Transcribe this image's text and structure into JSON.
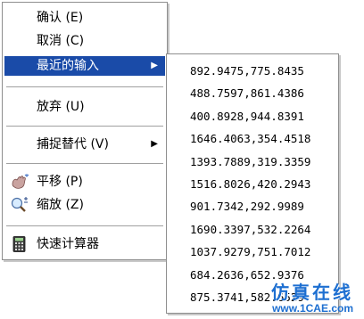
{
  "menu": {
    "items": [
      {
        "label": "确认 (E)"
      },
      {
        "label": "取消 (C)"
      },
      {
        "label": "最近的输入"
      },
      {
        "label": "放弃 (U)"
      },
      {
        "label": "捕捉替代 (V)"
      },
      {
        "label": "平移 (P)"
      },
      {
        "label": "缩放 (Z)"
      },
      {
        "label": "快速计算器"
      }
    ],
    "submenu_arrow": "▶"
  },
  "recent_inputs": [
    "892.9475,775.8435",
    "488.7597,861.4386",
    "400.8928,944.8391",
    "1646.4063,354.4518",
    "1393.7889,319.3359",
    "1516.8026,420.2943",
    "901.7342,292.9989",
    "1690.3397,532.2264",
    "1037.9279,751.7012",
    "684.2636,652.9376",
    "875.3741,582.6529"
  ],
  "watermark": {
    "cn": "仿真在线",
    "url": "www.1CAE.com",
    "bg": "1CAE.COM"
  },
  "colors": {
    "highlight": "#1a4ba8",
    "watermark": "#1d6fd1"
  },
  "icons": {
    "pan": "hand-pan-icon",
    "zoom": "magnifier-zoom-icon",
    "calculator": "calculator-icon"
  }
}
